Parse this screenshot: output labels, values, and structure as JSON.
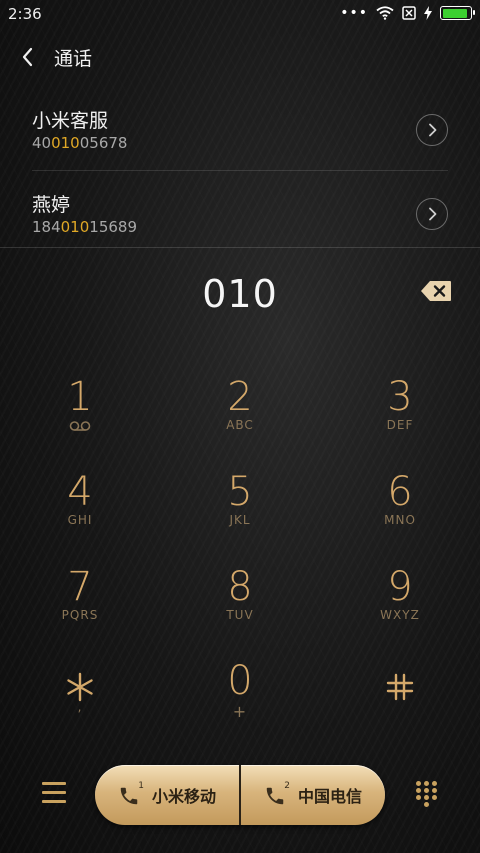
{
  "status": {
    "time": "2:36",
    "battery_color": "#3cd030"
  },
  "header": {
    "title": "通话"
  },
  "contacts": [
    {
      "name": "小米客服",
      "num_pre": "40",
      "num_hl": "010",
      "num_post": "05678"
    },
    {
      "name": "燕婷",
      "num_pre": "184",
      "num_hl": "010",
      "num_post": "15689"
    }
  ],
  "dial": {
    "value": "010"
  },
  "keys": [
    {
      "digit": "1",
      "letters": ""
    },
    {
      "digit": "2",
      "letters": "ABC"
    },
    {
      "digit": "3",
      "letters": "DEF"
    },
    {
      "digit": "4",
      "letters": "GHI"
    },
    {
      "digit": "5",
      "letters": "JKL"
    },
    {
      "digit": "6",
      "letters": "MNO"
    },
    {
      "digit": "7",
      "letters": "PQRS"
    },
    {
      "digit": "8",
      "letters": "TUV"
    },
    {
      "digit": "9",
      "letters": "WXYZ"
    },
    {
      "digit": "*",
      "letters": ","
    },
    {
      "digit": "0",
      "letters": "+"
    },
    {
      "digit": "#",
      "letters": ""
    }
  ],
  "bottom": {
    "sim1_label": "小米移动",
    "sim1_num": "1",
    "sim2_label": "中国电信",
    "sim2_num": "2"
  },
  "colors": {
    "accent_gold": "#d4a86a",
    "highlight": "#e0a826"
  }
}
